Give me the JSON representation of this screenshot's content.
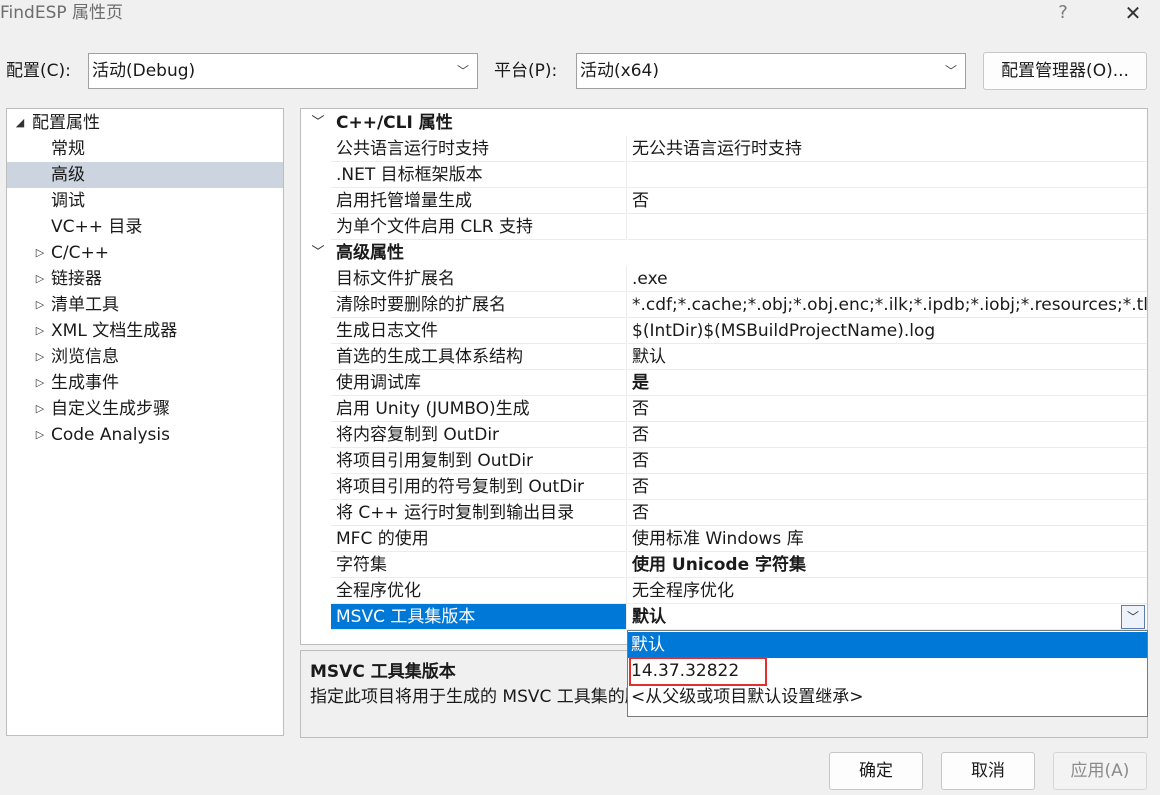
{
  "window": {
    "title": "FindESP 属性页",
    "help": "?",
    "close": "✕"
  },
  "config": {
    "config_label": "配置(C):",
    "config_value": "活动(Debug)",
    "platform_label": "平台(P):",
    "platform_value": "活动(x64)",
    "manager_button": "配置管理器(O)..."
  },
  "tree": {
    "items": [
      {
        "label": "配置属性",
        "twisty": "◢"
      },
      {
        "label": "常规"
      },
      {
        "label": "高级",
        "selected": true
      },
      {
        "label": "调试"
      },
      {
        "label": "VC++ 目录"
      },
      {
        "label": "C/C++",
        "twisty": "▷"
      },
      {
        "label": "链接器",
        "twisty": "▷"
      },
      {
        "label": "清单工具",
        "twisty": "▷"
      },
      {
        "label": "XML 文档生成器",
        "twisty": "▷"
      },
      {
        "label": "浏览信息",
        "twisty": "▷"
      },
      {
        "label": "生成事件",
        "twisty": "▷"
      },
      {
        "label": "自定义生成步骤",
        "twisty": "▷"
      },
      {
        "label": "Code Analysis",
        "twisty": "▷"
      }
    ]
  },
  "grid": {
    "sections": [
      {
        "title": "C++/CLI 属性",
        "rows": [
          {
            "name": "公共语言运行时支持",
            "value": "无公共语言运行时支持"
          },
          {
            "name": ".NET 目标框架版本",
            "value": ""
          },
          {
            "name": "启用托管增量生成",
            "value": "否"
          },
          {
            "name": "为单个文件启用 CLR 支持",
            "value": ""
          }
        ]
      },
      {
        "title": "高级属性",
        "rows": [
          {
            "name": "目标文件扩展名",
            "value": ".exe"
          },
          {
            "name": "清除时要删除的扩展名",
            "value": "*.cdf;*.cache;*.obj;*.obj.enc;*.ilk;*.ipdb;*.iobj;*.resources;*.tlb;*.tli;*.tlh;*.tmp;*.rsp"
          },
          {
            "name": "生成日志文件",
            "value": "$(IntDir)$(MSBuildProjectName).log"
          },
          {
            "name": "首选的生成工具体系结构",
            "value": "默认"
          },
          {
            "name": "使用调试库",
            "value": "是",
            "bold": true
          },
          {
            "name": "启用 Unity (JUMBO)生成",
            "value": "否"
          },
          {
            "name": "将内容复制到 OutDir",
            "value": "否"
          },
          {
            "name": "将项目引用复制到 OutDir",
            "value": "否"
          },
          {
            "name": "将项目引用的符号复制到 OutDir",
            "value": "否"
          },
          {
            "name": "将 C++ 运行时复制到输出目录",
            "value": "否"
          },
          {
            "name": "MFC 的使用",
            "value": "使用标准 Windows 库"
          },
          {
            "name": "字符集",
            "value": "使用 Unicode 字符集",
            "bold": true
          },
          {
            "name": "全程序优化",
            "value": "无全程序优化"
          },
          {
            "name": "MSVC 工具集版本",
            "value": "默认",
            "bold": true,
            "selected": true
          }
        ]
      }
    ]
  },
  "dropdown": {
    "options": [
      "默认",
      "14.37.32822",
      "<从父级或项目默认设置继承>"
    ],
    "highlighted_index": 0
  },
  "description": {
    "title": "MSVC 工具集版本",
    "text": "指定此项目将用于生成的 MSVC 工具集的版本。"
  },
  "buttons": {
    "ok": "确定",
    "cancel": "取消",
    "apply": "应用(A)"
  },
  "colors": {
    "selection": "#0078d7",
    "annotation_box": "#e03030"
  }
}
